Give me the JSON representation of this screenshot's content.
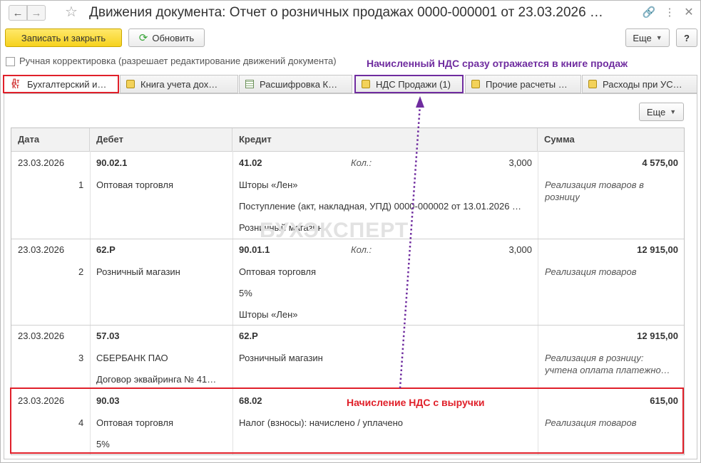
{
  "window": {
    "title": "Движения документа: Отчет о розничных продажах 0000-000001 от 23.03.2026 …",
    "icons": [
      "arrow-left-icon",
      "arrow-right-icon",
      "star-icon",
      "link-icon",
      "more-vertical-icon",
      "close-icon"
    ]
  },
  "toolbar": {
    "save_close": "Записать и закрыть",
    "refresh": "Обновить",
    "more": "Еще",
    "help": "?"
  },
  "manual_correction": {
    "checked": false,
    "label": "Ручная корректировка (разрешает редактирование движений документа)"
  },
  "annotations": {
    "vat_book": "Начисленный НДС сразу отражается в книге продаж",
    "vat_charge": "Начисление НДС с выручки",
    "accent_red": "#e0202a",
    "accent_purple": "#6f2c9f"
  },
  "watermark": "БУХЭКСПЕРТ",
  "tabs": [
    {
      "label": "Бухгалтерский и…",
      "icon": "dt-kt-icon",
      "active": true
    },
    {
      "label": "Книга учета дох…",
      "icon": "document-icon"
    },
    {
      "label": "Расшифровка К…",
      "icon": "grid-icon"
    },
    {
      "label": "НДС Продажи (1)",
      "icon": "document-icon",
      "highlighted": true
    },
    {
      "label": "Прочие расчеты …",
      "icon": "document-icon"
    },
    {
      "label": "Расходы при УС…",
      "icon": "document-icon"
    }
  ],
  "table": {
    "more": "Еще",
    "columns": {
      "date": "Дата",
      "debit": "Дебет",
      "credit": "Кредит",
      "sum": "Сумма"
    },
    "rows": [
      {
        "date": "23.03.2026",
        "num": "1",
        "debit_account": "90.02.1",
        "debit_sub": [
          "Оптовая торговля"
        ],
        "credit_account": "41.02",
        "qty_label": "Кол.:",
        "qty": "3,000",
        "credit_sub": [
          "Шторы «Лен»",
          "Поступление (акт, накладная, УПД) 0000-000002 от 13.01.2026 …",
          "Розничный магазин"
        ],
        "sum": "4 575,00",
        "content": [
          "Реализация товаров в",
          "розницу"
        ]
      },
      {
        "date": "23.03.2026",
        "num": "2",
        "debit_account": "62.Р",
        "debit_sub": [
          "Розничный магазин"
        ],
        "credit_account": "90.01.1",
        "qty_label": "Кол.:",
        "qty": "3,000",
        "credit_sub": [
          "Оптовая торговля",
          "5%",
          "Шторы «Лен»"
        ],
        "sum": "12 915,00",
        "content": [
          "Реализация товаров"
        ]
      },
      {
        "date": "23.03.2026",
        "num": "3",
        "debit_account": "57.03",
        "debit_sub": [
          "СБЕРБАНК ПАО",
          "Договор эквайринга № 41…"
        ],
        "credit_account": "62.Р",
        "credit_sub": [
          "Розничный магазин"
        ],
        "sum": "12 915,00",
        "content": [
          "Реализация в розницу:",
          "учтена оплата платежно…"
        ]
      },
      {
        "date": "23.03.2026",
        "num": "4",
        "debit_account": "90.03",
        "debit_sub": [
          "Оптовая торговля",
          "5%"
        ],
        "credit_account": "68.02",
        "credit_sub": [
          "Налог (взносы): начислено / уплачено"
        ],
        "sum": "615,00",
        "content": [
          "Реализация товаров"
        ]
      }
    ]
  }
}
